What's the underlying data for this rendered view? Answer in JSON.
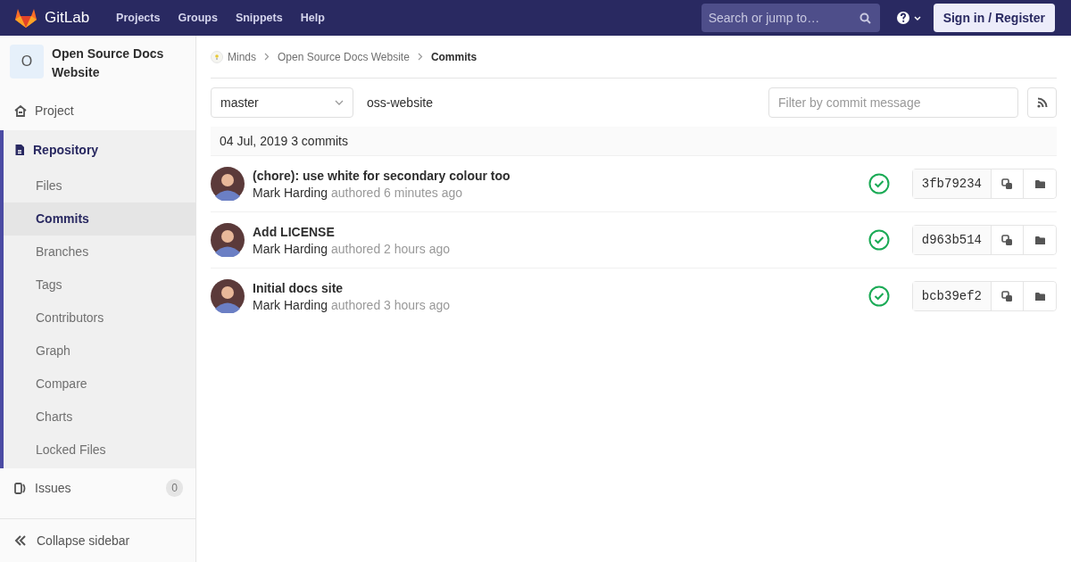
{
  "navbar": {
    "brand": "GitLab",
    "links": [
      "Projects",
      "Groups",
      "Snippets",
      "Help"
    ],
    "search": {
      "placeholder": "Search or jump to…"
    },
    "sign_in": "Sign in / Register"
  },
  "sidebar": {
    "project_avatar": "O",
    "project_name": "Open Source Docs Website",
    "items": [
      {
        "label": "Project",
        "selected": false
      },
      {
        "label": "Repository",
        "selected": true,
        "expanded": true,
        "children": [
          {
            "label": "Files",
            "selected": false
          },
          {
            "label": "Commits",
            "selected": true
          },
          {
            "label": "Branches",
            "selected": false
          },
          {
            "label": "Tags",
            "selected": false
          },
          {
            "label": "Contributors",
            "selected": false
          },
          {
            "label": "Graph",
            "selected": false
          },
          {
            "label": "Compare",
            "selected": false
          },
          {
            "label": "Charts",
            "selected": false
          },
          {
            "label": "Locked Files",
            "selected": false
          }
        ]
      },
      {
        "label": "Issues",
        "selected": false,
        "count": "0"
      }
    ],
    "collapse": "Collapse sidebar"
  },
  "breadcrumbs": [
    "Minds",
    "Open Source Docs Website",
    "Commits"
  ],
  "toolbar": {
    "branch": "master",
    "path": "oss-website",
    "filter": {
      "placeholder": "Filter by commit message"
    }
  },
  "day_header": "04 Jul, 2019 3 commits",
  "commits": [
    {
      "title": "(chore): use white for secondary colour too",
      "author": "Mark Harding",
      "time": "authored 6 minutes ago",
      "passed": true,
      "sha": "3fb79234"
    },
    {
      "title": "Add LICENSE",
      "author": "Mark Harding",
      "time": "authored 2 hours ago",
      "passed": true,
      "sha": "d963b514"
    },
    {
      "title": "Initial docs site",
      "author": "Mark Harding",
      "time": "authored 3 hours ago",
      "passed": true,
      "sha": "bcb39ef2"
    }
  ]
}
